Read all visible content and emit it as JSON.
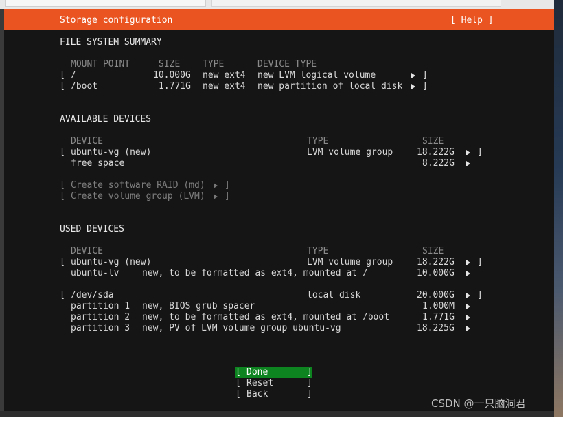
{
  "header": {
    "title": "Storage configuration",
    "help": "[ Help ]"
  },
  "fs_summary": {
    "heading": "FILE SYSTEM SUMMARY",
    "columns": [
      "MOUNT POINT",
      "SIZE",
      "TYPE",
      "DEVICE TYPE"
    ],
    "rows": [
      {
        "mount": "/",
        "size": "10.000G",
        "type": "new ext4",
        "device_type": "new LVM logical volume"
      },
      {
        "mount": "/boot",
        "size": "1.771G",
        "type": "new ext4",
        "device_type": "new partition of local disk"
      }
    ]
  },
  "available": {
    "heading": "AVAILABLE DEVICES",
    "columns": [
      "DEVICE",
      "TYPE",
      "SIZE"
    ],
    "rows": [
      {
        "device": "ubuntu-vg (new)",
        "type": "LVM volume group",
        "size": "18.222G"
      },
      {
        "device": "free space",
        "type": "",
        "size": "8.222G"
      }
    ],
    "actions": [
      "Create software RAID (md)",
      "Create volume group (LVM)"
    ]
  },
  "used": {
    "heading": "USED DEVICES",
    "columns": [
      "DEVICE",
      "TYPE",
      "SIZE"
    ],
    "rows": [
      {
        "device": "ubuntu-vg (new)",
        "desc": "",
        "type": "LVM volume group",
        "size": "18.222G"
      },
      {
        "device": "ubuntu-lv",
        "desc": "new, to be formatted as ext4, mounted at /",
        "type": "",
        "size": "10.000G"
      },
      {
        "device": "/dev/sda",
        "desc": "",
        "type": "local disk",
        "size": "20.000G"
      },
      {
        "device": "partition 1",
        "desc": "new, BIOS grub spacer",
        "type": "",
        "size": "1.000M"
      },
      {
        "device": "partition 2",
        "desc": "new, to be formatted as ext4, mounted at /boot",
        "type": "",
        "size": "1.771G"
      },
      {
        "device": "partition 3",
        "desc": "new, PV of LVM volume group ubuntu-vg",
        "type": "",
        "size": "18.225G"
      }
    ]
  },
  "buttons": {
    "done": "Done",
    "reset": "Reset",
    "back": "Back"
  },
  "watermark": "CSDN @一只脑洞君",
  "colors": {
    "header_bg": "#e95420",
    "screen_bg": "#151515",
    "done_bg": "#0e8420"
  }
}
